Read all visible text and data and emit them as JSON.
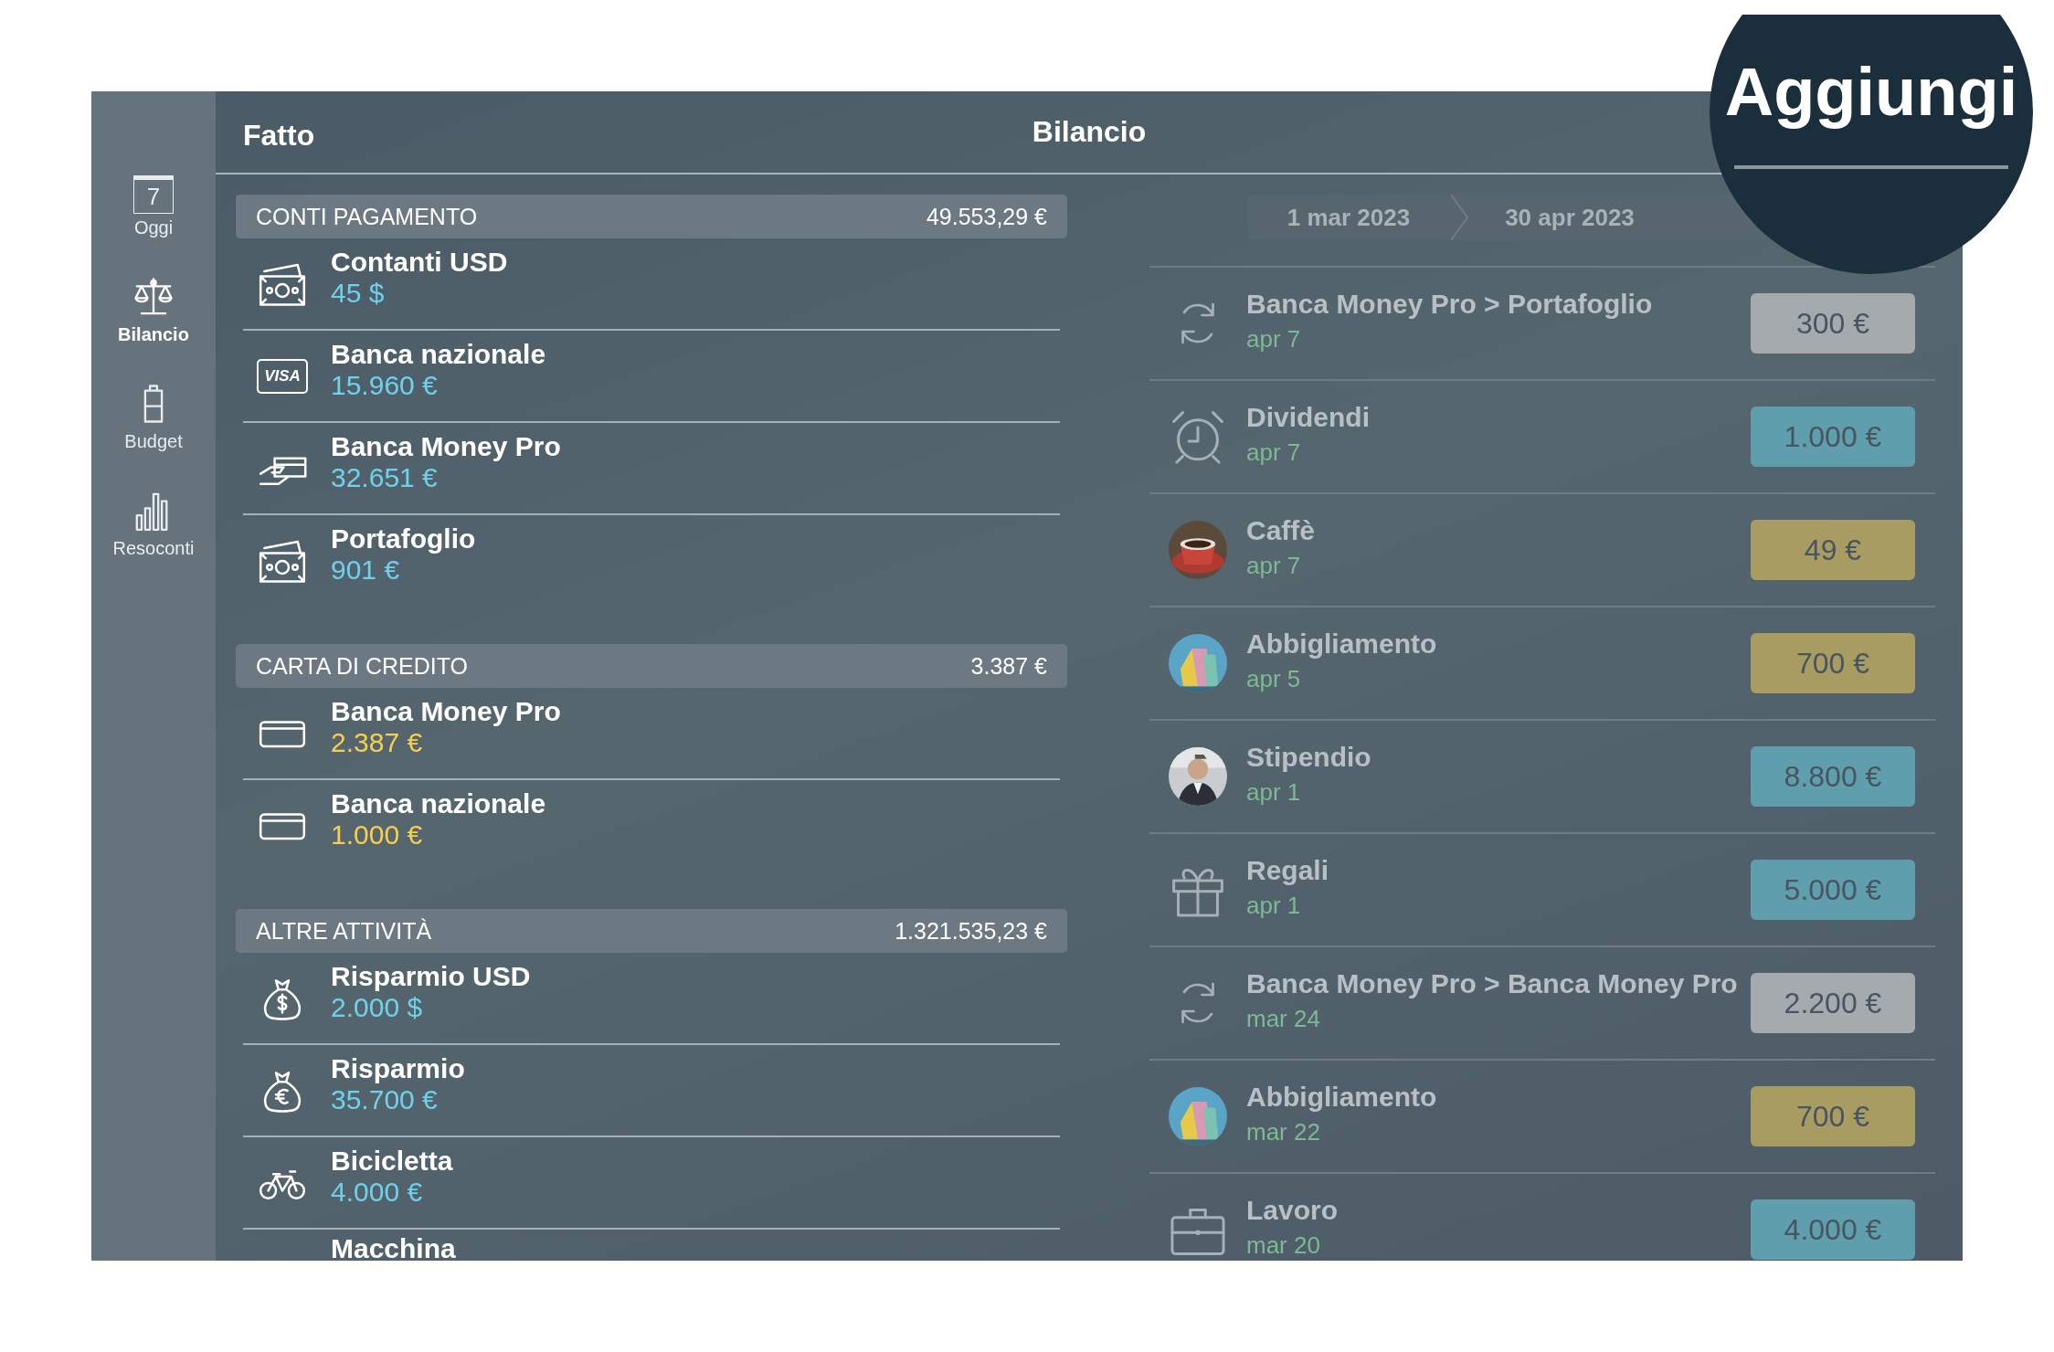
{
  "sidebar": {
    "items": [
      {
        "label": "Oggi",
        "kind": "calendar",
        "day": "7",
        "selected": false
      },
      {
        "label": "Bilancio",
        "kind": "scales",
        "selected": true
      },
      {
        "label": "Budget",
        "kind": "jar",
        "selected": false
      },
      {
        "label": "Resoconti",
        "kind": "chart",
        "selected": false
      }
    ]
  },
  "header": {
    "done_button": "Fatto",
    "title": "Bilancio"
  },
  "magnifier": {
    "text": "Aggiungi"
  },
  "accounts": [
    {
      "title": "CONTI PAGAMENTO",
      "total": "49.553,29 €",
      "items": [
        {
          "name": "Contanti USD",
          "amount": "45 $",
          "kind": "cash",
          "color": "#6fd2ea"
        },
        {
          "name": "Banca nazionale",
          "amount": "15.960 €",
          "kind": "visa",
          "brand": "VISA",
          "color": "#6fd2ea"
        },
        {
          "name": "Banca Money Pro",
          "amount": "32.651 €",
          "kind": "hand-card",
          "color": "#6fd2ea"
        },
        {
          "name": "Portafoglio",
          "amount": "901 €",
          "kind": "cash",
          "color": "#6fd2ea"
        }
      ]
    },
    {
      "title": "CARTA DI CREDITO",
      "total": "3.387 €",
      "items": [
        {
          "name": "Banca Money Pro",
          "amount": "2.387 €",
          "kind": "card",
          "color": "#f6cf4d"
        },
        {
          "name": "Banca nazionale",
          "amount": "1.000 €",
          "kind": "card",
          "color": "#f6cf4d"
        }
      ]
    },
    {
      "title": "ALTRE ATTIVITÀ",
      "total": "1.321.535,23 €",
      "items": [
        {
          "name": "Risparmio USD",
          "amount": "2.000 $",
          "kind": "bag-dollar",
          "color": "#6fd2ea"
        },
        {
          "name": "Risparmio",
          "amount": "35.700 €",
          "kind": "bag-euro",
          "color": "#6fd2ea"
        },
        {
          "name": "Bicicletta",
          "amount": "4.000 €",
          "kind": "bicycle",
          "color": "#6fd2ea"
        },
        {
          "name": "Macchina"
        }
      ]
    }
  ],
  "date_range": {
    "from": "1 mar 2023",
    "to": "30 apr 2023"
  },
  "transactions": [
    {
      "title": "Banca Money Pro > Portafoglio",
      "date": "apr 7",
      "amount": "300 €",
      "kind": "refresh",
      "color": "#a4aaae"
    },
    {
      "title": "Dividendi",
      "date": "apr 7",
      "amount": "1.000 €",
      "kind": "alarm",
      "color": "#5f9fad"
    },
    {
      "title": "Caffè",
      "date": "apr 7",
      "amount": "49 €",
      "kind": "coffee",
      "color": "#a89c62"
    },
    {
      "title": "Abbigliamento",
      "date": "apr 5",
      "amount": "700 €",
      "kind": "bags",
      "color": "#a89c62"
    },
    {
      "title": "Stipendio",
      "date": "apr 1",
      "amount": "8.800 €",
      "kind": "person",
      "color": "#5f9fad"
    },
    {
      "title": "Regali",
      "date": "apr 1",
      "amount": "5.000 €",
      "kind": "gift",
      "color": "#5f9fad"
    },
    {
      "title": "Banca Money Pro > Banca Money Pro",
      "date": "mar 24",
      "amount": "2.200 €",
      "kind": "refresh",
      "color": "#a4aaae"
    },
    {
      "title": "Abbigliamento",
      "date": "mar 22",
      "amount": "700 €",
      "kind": "bags",
      "color": "#a89c62"
    },
    {
      "title": "Lavoro",
      "date": "mar 20",
      "amount": "4.000 €",
      "kind": "briefcase",
      "color": "#5f9fad"
    }
  ]
}
